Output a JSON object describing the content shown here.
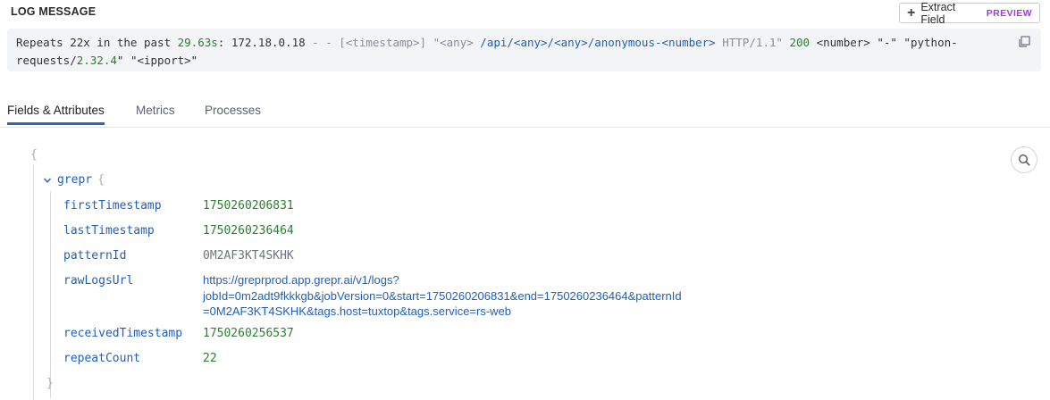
{
  "header": {
    "title": "LOG MESSAGE",
    "extract_button": {
      "label": "Extract Field",
      "badge": "PREVIEW"
    }
  },
  "message": {
    "p1": "Repeats 22x in the past ",
    "duration": "29.63s",
    "p2": ": 172.18.0.18 ",
    "dashes": "- -",
    "p3": " [<timestamp>] \"<any> ",
    "path": "/api/<any>/<any>/anonymous-<number>",
    "p4": " HTTP/1.1\" ",
    "status": "200",
    "p5": " <number> \"-\" \"python-",
    "p6": "requests/",
    "version": "2.32.4",
    "p7": "\" \"<ipport>\""
  },
  "tabs": [
    {
      "label": "Fields & Attributes",
      "active": true
    },
    {
      "label": "Metrics",
      "active": false
    },
    {
      "label": "Processes",
      "active": false
    }
  ],
  "tree": {
    "open_brace": "{",
    "close_brace": "}",
    "group_key": "grepr",
    "group_open": "{",
    "fields": {
      "firstTimestamp": {
        "key": "firstTimestamp",
        "value": "1750260206831"
      },
      "lastTimestamp": {
        "key": "lastTimestamp",
        "value": "1750260236464"
      },
      "patternId": {
        "key": "patternId",
        "value": "0M2AF3KT4SKHK"
      },
      "rawLogsUrl": {
        "key": "rawLogsUrl",
        "line1": "https://greprprod.app.grepr.ai/v1/logs?",
        "line2": "jobId=0m2adt9fkkkgb&jobVersion=0&start=1750260206831&end=1750260236464&patternId",
        "line3": "=0M2AF3KT4SKHK&tags.host=tuxtop&tags.service=rs-web"
      },
      "receivedTimestamp": {
        "key": "receivedTimestamp",
        "value": "1750260256537"
      },
      "repeatCount": {
        "key": "repeatCount",
        "value": "22"
      }
    }
  },
  "icons": {
    "copy": "copy-icon",
    "search": "search-icon",
    "chevron": "chevron-down-icon",
    "plus": "plus-icon"
  },
  "colors": {
    "accent": "#2f63c7",
    "preview": "#9b3fd1",
    "number": "#2e7d32",
    "key": "#1f5fbf"
  }
}
